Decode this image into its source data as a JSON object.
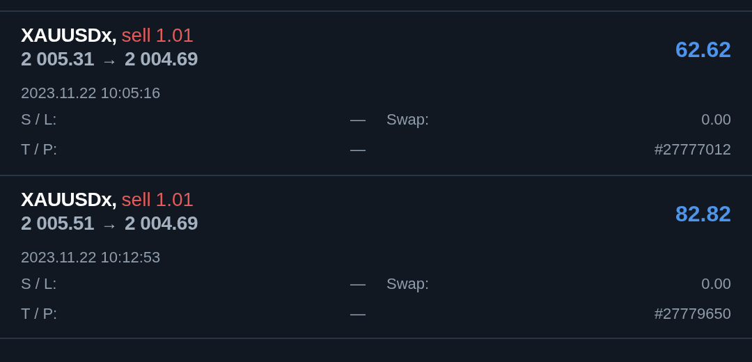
{
  "positions": [
    {
      "symbol": "XAUUSDx,",
      "type": "sell",
      "volume": "1.01",
      "open_price": "2 005.31",
      "arrow": "→",
      "close_price": "2 004.69",
      "profit": "62.62",
      "time": "2023.11.22 10:05:16",
      "sl_label": "S / L:",
      "sl_value": "—",
      "swap_label": "Swap:",
      "swap_value": "0.00",
      "tp_label": "T / P:",
      "tp_value": "—",
      "ticket": "#27777012"
    },
    {
      "symbol": "XAUUSDx,",
      "type": "sell",
      "volume": "1.01",
      "open_price": "2 005.51",
      "arrow": "→",
      "close_price": "2 004.69",
      "profit": "82.82",
      "time": "2023.11.22 10:12:53",
      "sl_label": "S / L:",
      "sl_value": "—",
      "swap_label": "Swap:",
      "swap_value": "0.00",
      "tp_label": "T / P:",
      "tp_value": "—",
      "ticket": "#27779650"
    }
  ]
}
